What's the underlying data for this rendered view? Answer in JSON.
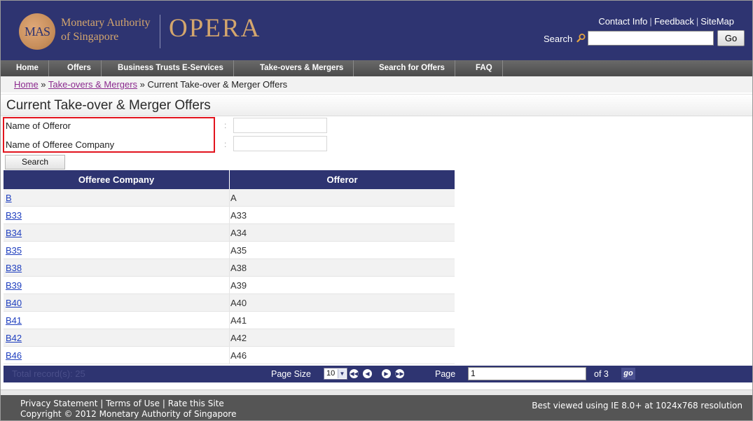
{
  "header": {
    "logo_text": "MAS",
    "org_line1": "Monetary Authority",
    "org_line2": "of Singapore",
    "app_title": "OPERA",
    "links": [
      "Contact Info",
      "Feedback",
      "SiteMap"
    ],
    "search_label": "Search",
    "search_value": "",
    "go_label": "Go"
  },
  "nav": {
    "items": [
      "Home",
      "Offers",
      "Business Trusts E-Services",
      "Take-overs & Mergers",
      "Search for Offers",
      "FAQ"
    ]
  },
  "breadcrumb": {
    "home": "Home",
    "sep1": " » ",
    "section": "Take-overs & Mergers",
    "sep2": " » ",
    "current": "Current Take-over & Merger Offers"
  },
  "page_title": "Current Take-over & Merger Offers",
  "form": {
    "offeror_label": "Name of Offeror",
    "offeree_label": "Name of Offeree Company",
    "colon": ":",
    "offeror_value": "",
    "offeree_value": "",
    "search_button": "Search"
  },
  "table": {
    "headers": [
      "Offeree Company",
      "Offeror"
    ],
    "rows": [
      {
        "company": "B",
        "offeror": "A"
      },
      {
        "company": "B33",
        "offeror": "A33"
      },
      {
        "company": "B34",
        "offeror": "A34"
      },
      {
        "company": "B35",
        "offeror": "A35"
      },
      {
        "company": "B38",
        "offeror": "A38"
      },
      {
        "company": "B39",
        "offeror": "A39"
      },
      {
        "company": "B40",
        "offeror": "A40"
      },
      {
        "company": "B41",
        "offeror": "A41"
      },
      {
        "company": "B42",
        "offeror": "A42"
      },
      {
        "company": "B46",
        "offeror": "A46"
      }
    ]
  },
  "pager": {
    "total_records": "Total record(s): 25",
    "page_size_label": "Page Size",
    "page_size_value": "10",
    "page_label": "Page",
    "page_value": "1",
    "of_pages": "of 3",
    "go_label": "go"
  },
  "footer": {
    "links_line": "Privacy Statement | Terms of Use | Rate this Site",
    "copyright": "Copyright © 2012 Monetary Authority of Singapore",
    "best_viewed": "Best viewed using IE 8.0+ at 1024x768 resolution"
  }
}
